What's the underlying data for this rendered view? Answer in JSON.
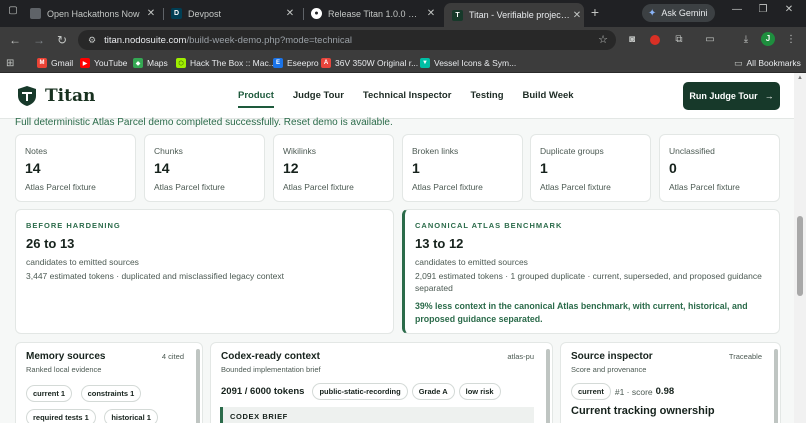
{
  "browser": {
    "tabs": [
      {
        "title": "Open Hackathons Now",
        "favicon_color": "#5f6368"
      },
      {
        "title": "Devpost",
        "favicon_color": "#003e54"
      },
      {
        "title": "Release Titan 1.0.0 — OpenAI ...",
        "favicon_color": "#ffffff"
      },
      {
        "title": "Titan - Verifiable project memory",
        "favicon_color": "#17392a"
      }
    ],
    "ask_gemini": "Ask Gemini",
    "url_host": "titan.nodosuite.com",
    "url_path": "/build-week-demo.php?mode=technical",
    "profile_initial": "J",
    "bookmarks": [
      "Gmail",
      "YouTube",
      "Maps",
      "Hack The Box :: Mac...",
      "Eseepro",
      "36V 350W Original r...",
      "Vessel Icons & Sym..."
    ],
    "all_bookmarks": "All Bookmarks"
  },
  "site": {
    "brand": "Titan",
    "nav": [
      "Product",
      "Judge Tour",
      "Technical Inspector",
      "Testing",
      "Build Week"
    ],
    "active_nav": "Product",
    "cta": "Run Judge Tour",
    "cta_arrow": "→"
  },
  "notice": "Full deterministic Atlas Parcel demo completed successfully. Reset demo is available.",
  "stats": [
    {
      "label": "Notes",
      "value": "14",
      "sub": "Atlas Parcel fixture"
    },
    {
      "label": "Chunks",
      "value": "14",
      "sub": "Atlas Parcel fixture"
    },
    {
      "label": "Wikilinks",
      "value": "12",
      "sub": "Atlas Parcel fixture"
    },
    {
      "label": "Broken links",
      "value": "1",
      "sub": "Atlas Parcel fixture"
    },
    {
      "label": "Duplicate groups",
      "value": "1",
      "sub": "Atlas Parcel fixture"
    },
    {
      "label": "Unclassified",
      "value": "0",
      "sub": "Atlas Parcel fixture"
    }
  ],
  "before": {
    "eyebrow": "BEFORE HARDENING",
    "big": "26 to 13",
    "line1": "candidates to emitted sources",
    "line2": "3,447 estimated tokens · duplicated and misclassified legacy context"
  },
  "canonical": {
    "eyebrow": "CANONICAL ATLAS BENCHMARK",
    "big": "13 to 12",
    "line1": "candidates to emitted sources",
    "line2": "2,091 estimated tokens · 1 grouped duplicate · current, superseded, and proposed guidance separated",
    "highlight": "39% less context in the canonical Atlas benchmark, with current, historical, and proposed guidance separated."
  },
  "memory": {
    "title": "Memory sources",
    "right": "4 cited",
    "sub": "Ranked local evidence",
    "chips_row1": [
      "current 1",
      "constraints 1"
    ],
    "chips_row2": [
      "required tests 1",
      "historical 1"
    ]
  },
  "context": {
    "title": "Codex-ready context",
    "right": "atlas-pu",
    "sub": "Bounded implementation brief",
    "tokens": "2091 / 6000 tokens",
    "chips": [
      "public-static-recording",
      "Grade A",
      "low risk"
    ],
    "brief": "CODEX BRIEF"
  },
  "inspector": {
    "title": "Source inspector",
    "right": "Traceable",
    "sub": "Score and provenance",
    "chip": "current",
    "rank": "#1 · score",
    "score": "0.98",
    "heading": "Current tracking ownership"
  }
}
